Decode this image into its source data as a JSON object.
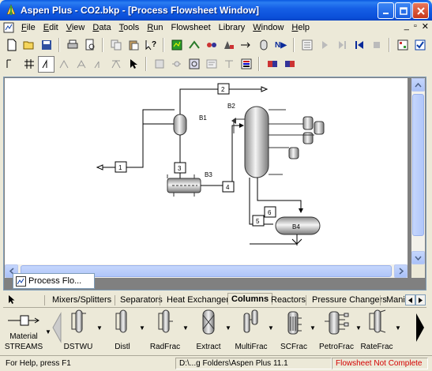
{
  "window": {
    "title": "Aspen Plus - CO2.bkp - [Process Flowsheet Window]",
    "minimize_glyph": "_",
    "maximize_glyph": "□",
    "close_glyph": "✕"
  },
  "menu": {
    "items": [
      {
        "ul": "F",
        "rest": "ile"
      },
      {
        "ul": "E",
        "rest": "dit"
      },
      {
        "ul": "V",
        "rest": "iew"
      },
      {
        "ul": "D",
        "rest": "ata"
      },
      {
        "ul": "T",
        "rest": "ools"
      },
      {
        "ul": "R",
        "rest": "un"
      },
      {
        "ul": "",
        "rest": "Flowsheet"
      },
      {
        "ul": "",
        "rest": "Library"
      },
      {
        "ul": "W",
        "rest": "indow"
      },
      {
        "ul": "H",
        "rest": "elp"
      }
    ],
    "mdi_min": "_",
    "mdi_restore": "▫",
    "mdi_close": "✕"
  },
  "toolbar1": {
    "icons": [
      "new-icon",
      "open-icon",
      "save-icon",
      "print-icon",
      "print-preview-icon",
      "copy-icon",
      "paste-icon",
      "whats-this-icon",
      "data-browser-icon",
      "setup-icon",
      "components-icon",
      "properties-icon",
      "streams-icon",
      "blocks-icon",
      "next-icon",
      "run-control-icon",
      "run-icon",
      "step-icon",
      "rewind-icon",
      "stop-icon",
      "control-panel-icon",
      "results-icon",
      "check-results-icon",
      "model-library-icon"
    ],
    "next_label": "N▶"
  },
  "toolbar2": {
    "icons": [
      "align-icon",
      "grid-icon",
      "snap-icon",
      "zoom-full-icon",
      "zoom-in-icon",
      "zoom-out-icon",
      "flip-icon",
      "select-mode-icon",
      "insert-block-icon",
      "insert-stream-icon",
      "find-icon",
      "section-icon",
      "text-icon",
      "color-icon",
      "send-to-front-icon",
      "send-to-back-icon"
    ]
  },
  "flowsheet": {
    "blocks": [
      {
        "id": "B1",
        "type": "flash-drum"
      },
      {
        "id": "B2",
        "type": "radfrac-column"
      },
      {
        "id": "B3",
        "type": "heat-exchanger"
      },
      {
        "id": "B4",
        "type": "pump-vessel"
      }
    ],
    "streams": [
      "1",
      "2",
      "3",
      "4",
      "5",
      "6"
    ]
  },
  "document_tab": {
    "label": "Process Flo..."
  },
  "library": {
    "tabs": [
      "Mixers/Splitters",
      "Separators",
      "Heat Exchangers",
      "Columns",
      "Reactors",
      "Pressure Changers",
      "Manip"
    ],
    "active_tab": "Columns",
    "streams_label_1": "Material",
    "streams_label_2": "STREAMS",
    "models": [
      "DSTWU",
      "Distl",
      "RadFrac",
      "Extract",
      "MultiFrac",
      "SCFrac",
      "PetroFrac",
      "RateFrac"
    ],
    "dropdown_glyph": "▼"
  },
  "status": {
    "help": "For Help, press F1",
    "path": "D:\\...g Folders\\Aspen Plus 11.1",
    "state": "Flowsheet Not Complete",
    "state_color": "#d40000"
  }
}
